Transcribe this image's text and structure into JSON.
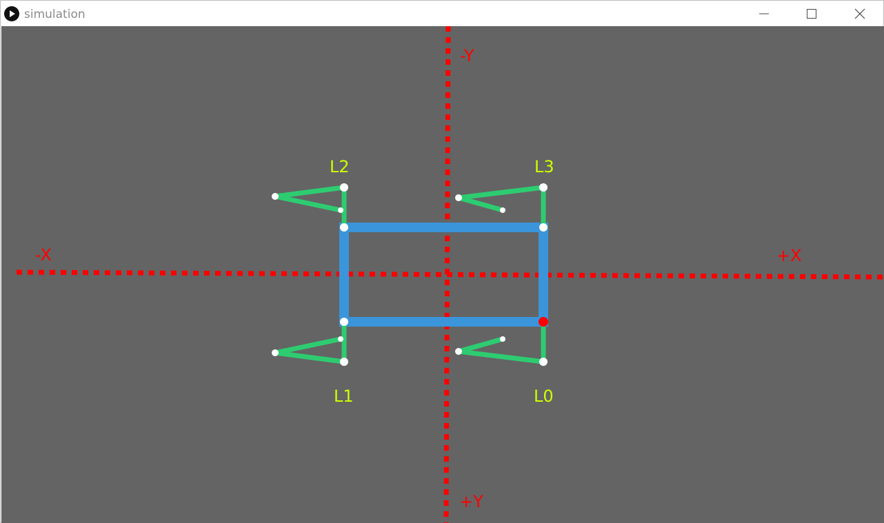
{
  "window": {
    "title": "simulation",
    "controls": {
      "minimize": "minimize-icon",
      "maximize": "maximize-icon",
      "close": "close-icon"
    }
  },
  "colors": {
    "canvas_bg": "#646464",
    "axis": "#ff0000",
    "body": "#3a95da",
    "leg": "#2ecc71",
    "joint": "#ffffff",
    "leg_label": "#ccff00",
    "highlight_joint": "#ff0000"
  },
  "axes": {
    "neg_x": "-X",
    "pos_x": "+X",
    "neg_y": "-Y",
    "pos_y": "+Y"
  },
  "legs": {
    "L0": "L0",
    "L1": "L1",
    "L2": "L2",
    "L3": "L3"
  }
}
